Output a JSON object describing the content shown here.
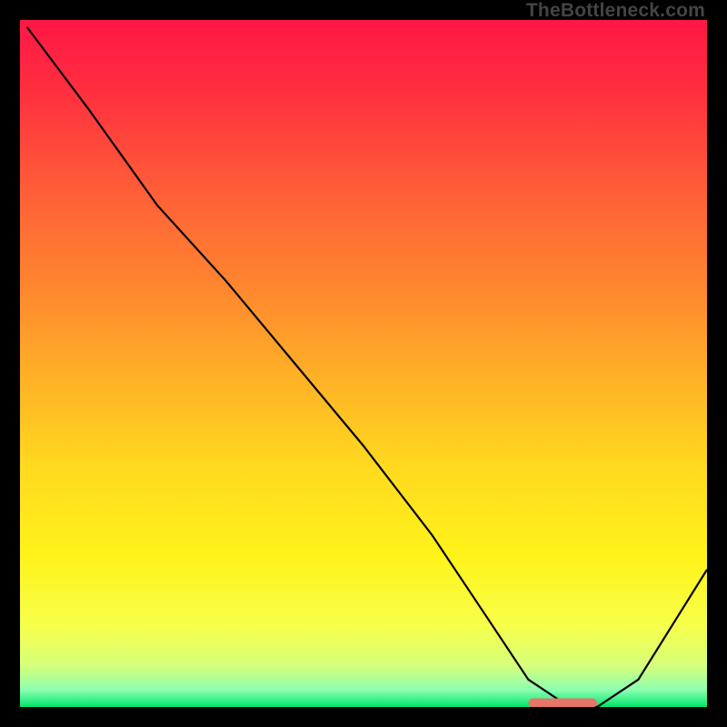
{
  "watermark": "TheBottleneck.com",
  "chart_data": {
    "type": "line",
    "title": "",
    "xlabel": "",
    "ylabel": "",
    "xlim": [
      0,
      100
    ],
    "ylim": [
      0,
      100
    ],
    "grid": false,
    "x": [
      1,
      10,
      20,
      30,
      40,
      50,
      60,
      68,
      74,
      80,
      84,
      90,
      100
    ],
    "values": [
      99,
      87,
      73,
      62,
      50,
      38,
      25,
      13,
      4,
      0,
      0,
      4,
      20
    ],
    "marker": {
      "x_start": 74,
      "x_end": 84,
      "y": 0.6,
      "color": "#e8746b"
    },
    "gradient_stops": [
      {
        "offset": 0.0,
        "color": "#ff1745"
      },
      {
        "offset": 0.1,
        "color": "#ff2e3f"
      },
      {
        "offset": 0.25,
        "color": "#ff5e38"
      },
      {
        "offset": 0.4,
        "color": "#ff8a2e"
      },
      {
        "offset": 0.52,
        "color": "#ffb126"
      },
      {
        "offset": 0.65,
        "color": "#ffd91f"
      },
      {
        "offset": 0.78,
        "color": "#fff31a"
      },
      {
        "offset": 0.88,
        "color": "#f7ff4a"
      },
      {
        "offset": 0.94,
        "color": "#d6ff7a"
      },
      {
        "offset": 0.975,
        "color": "#8dffb0"
      },
      {
        "offset": 1.0,
        "color": "#00e66b"
      }
    ]
  }
}
